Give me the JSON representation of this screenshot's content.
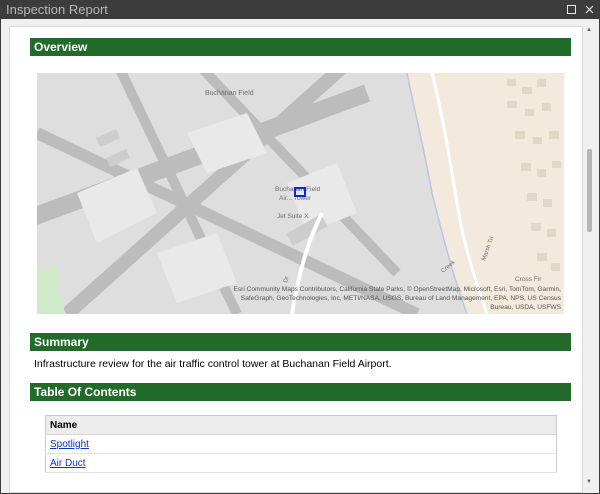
{
  "window": {
    "title": "Inspection Report",
    "maximize_icon": "maximize-icon",
    "close_icon": "close-icon"
  },
  "report": {
    "overview_header": "Overview",
    "map": {
      "labels": {
        "field": "Buchanan Field",
        "tower_line1": "Buchanan Field",
        "tower_line2": "Air... Tower",
        "suite": "Jet Suite X",
        "road1": "Dr",
        "road2": "Creek",
        "road3": "Marsh Tri",
        "cross": "Cross Fir"
      },
      "attribution": "Esri Community Maps Contributors, California State Parks, © OpenStreetMap, Microsoft, Esri, TomTom, Garmin, SafeGraph, GeoTechnologies, Inc, METI/NASA, USGS, Bureau of Land Management, EPA, NPS, US Census Bureau, USDA, USFWS"
    },
    "summary_header": "Summary",
    "summary_text": "Infrastructure review for the air traffic control tower at Buchanan Field Airport.",
    "toc_header": "Table Of Contents",
    "toc_table": {
      "column": "Name",
      "rows": [
        "Spotlight",
        "Air Duct"
      ]
    }
  },
  "colors": {
    "section_header_bg": "#236b2b",
    "link": "#0b35c9",
    "titlebar": "#3c3c3c"
  }
}
